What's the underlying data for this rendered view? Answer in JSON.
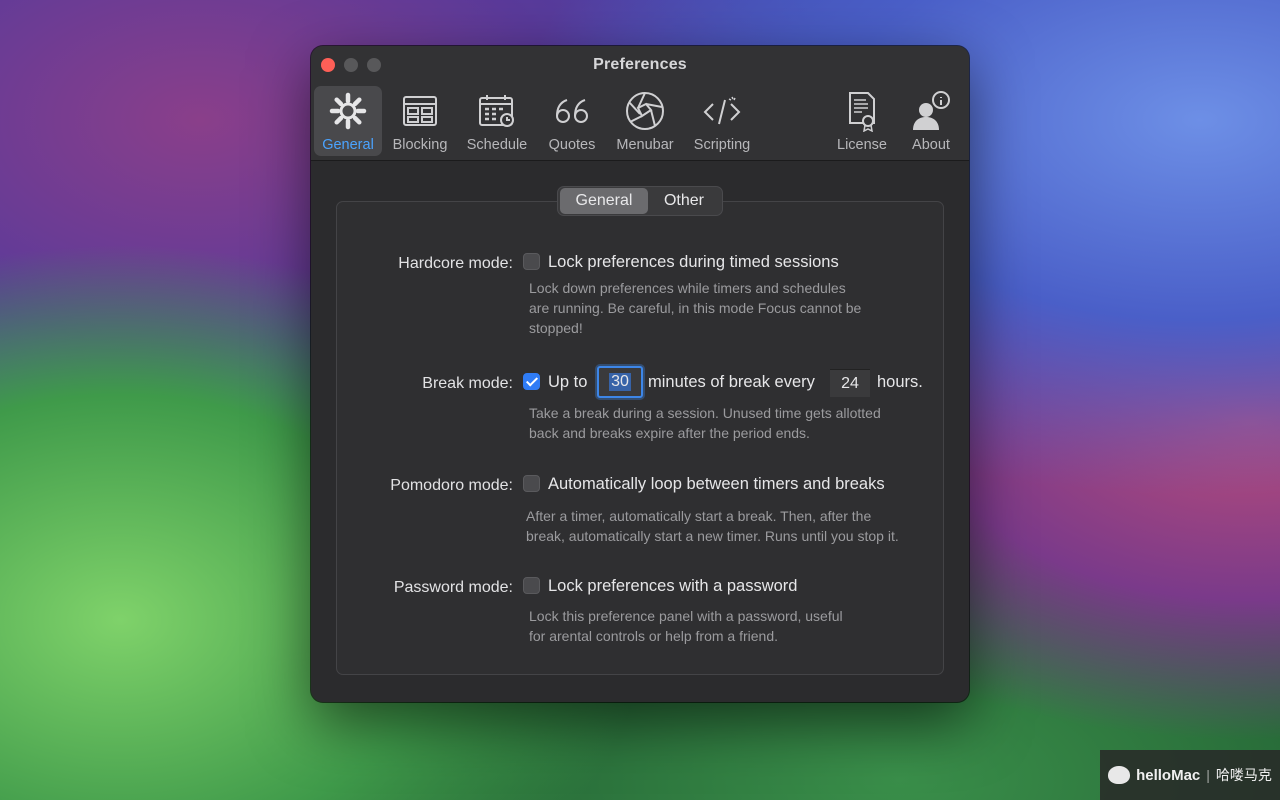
{
  "window": {
    "title": "Preferences"
  },
  "toolbar": {
    "items": [
      {
        "label": "General",
        "icon": "gear-icon",
        "active": true
      },
      {
        "label": "Blocking",
        "icon": "browser-window-icon"
      },
      {
        "label": "Schedule",
        "icon": "calendar-icon"
      },
      {
        "label": "Quotes",
        "icon": "quote-icon"
      },
      {
        "label": "Menubar",
        "icon": "aperture-icon"
      },
      {
        "label": "Scripting",
        "icon": "code-icon"
      },
      {
        "label": "License",
        "icon": "certificate-icon"
      },
      {
        "label": "About",
        "icon": "person-info-icon"
      }
    ]
  },
  "tabs": {
    "general": "General",
    "other": "Other",
    "selected": "General"
  },
  "hardcore": {
    "label": "Hardcore mode:",
    "option": "Lock preferences during timed sessions",
    "checked": false,
    "help1": "Lock down preferences while timers and schedules",
    "help2": "are running. Be careful, in this mode Focus cannot be",
    "help3": "stopped!"
  },
  "break": {
    "label": "Break mode:",
    "checked": true,
    "prefix": "Up to",
    "minutes": "30",
    "middle": "minutes of break every",
    "hours": "24",
    "suffix": "hours.",
    "help1": "Take a break during a session. Unused time gets allotted",
    "help2": "back and breaks expire after the period ends."
  },
  "pomodoro": {
    "label": "Pomodoro mode:",
    "option": "Automatically loop between timers and breaks",
    "checked": false,
    "help1": "After a timer, automatically start a break. Then, after the",
    "help2": "break, automatically start a new timer. Runs until you stop it."
  },
  "password": {
    "label": "Password mode:",
    "option": "Lock preferences with a password",
    "checked": false,
    "help1": "Lock this preference panel with a password, useful",
    "help2": "for arental controls or help from a friend."
  },
  "watermark": {
    "brand": "helloMac",
    "separator": "|",
    "cn": "哈喽马克"
  }
}
